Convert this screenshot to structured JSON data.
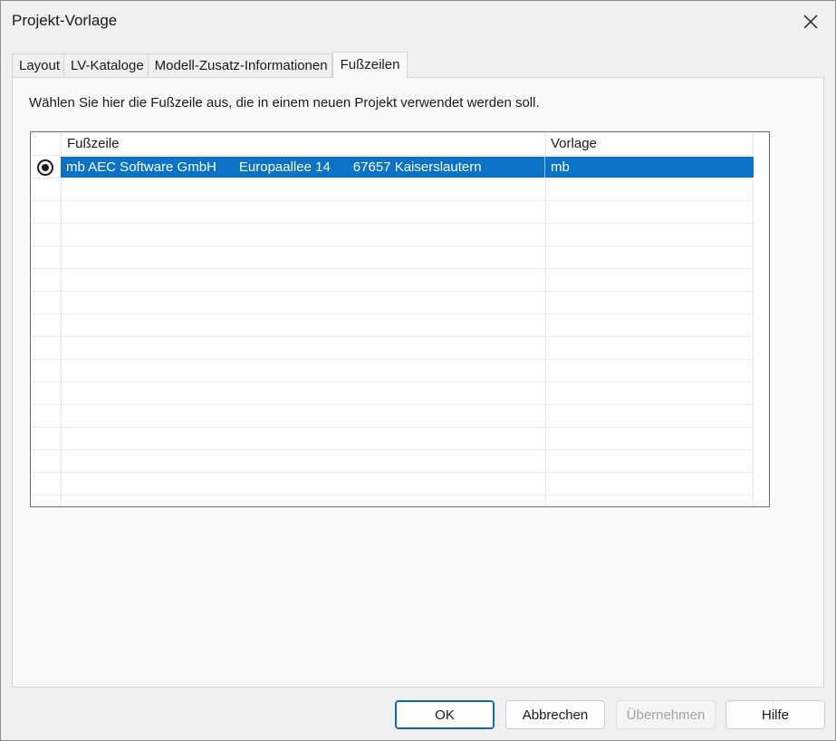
{
  "window": {
    "title": "Projekt-Vorlage"
  },
  "tabs": [
    {
      "label": "Layout"
    },
    {
      "label": "LV-Kataloge"
    },
    {
      "label": "Modell-Zusatz-Informationen"
    },
    {
      "label": "Fußzeilen",
      "active": true
    }
  ],
  "panel": {
    "instruction": "Wählen Sie hier die Fußzeile aus, die in einem neuen Projekt verwendet werden soll."
  },
  "table": {
    "columns": [
      "Fußzeile",
      "Vorlage"
    ],
    "rows": [
      {
        "selected": true,
        "footer": "mb AEC Software GmbH      Europaallee 14      67657 Kaiserslautern",
        "template": "mb"
      }
    ]
  },
  "buttons": {
    "ok": "OK",
    "cancel": "Abbrechen",
    "apply": "Übernehmen",
    "help": "Hilfe"
  },
  "colors": {
    "selection": "#0a73c8",
    "primary_border": "#0a67b8"
  },
  "icons": {
    "close": "close-icon",
    "radio": "radio-selected-icon"
  }
}
